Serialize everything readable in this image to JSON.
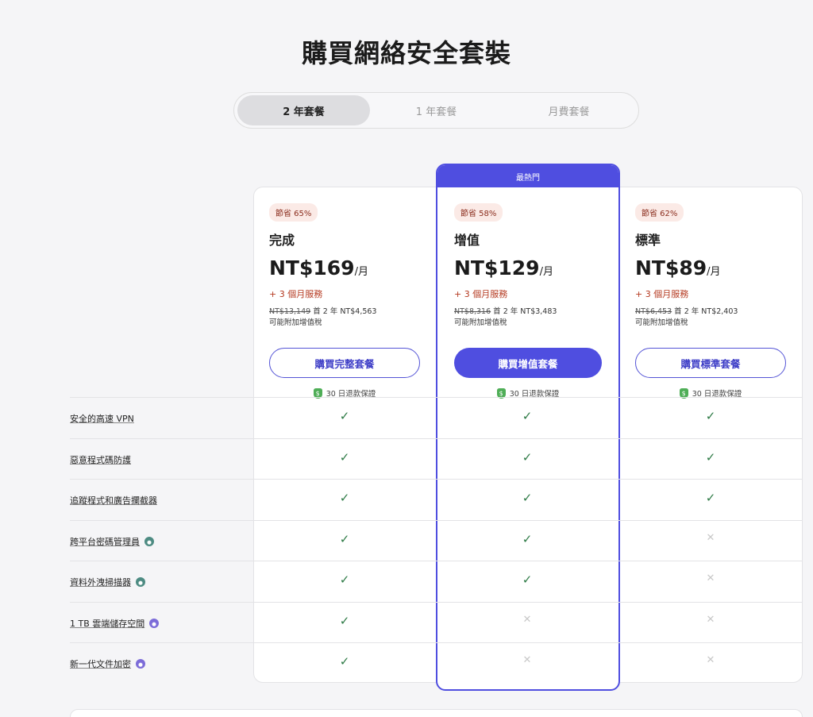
{
  "page": {
    "title": "購買網絡安全套裝"
  },
  "tabs": [
    {
      "label": "2 年套餐",
      "active": true
    },
    {
      "label": "1 年套餐",
      "active": false
    },
    {
      "label": "月費套餐",
      "active": false
    }
  ],
  "featured_label": "最熱門",
  "plans": [
    {
      "badge": "節省 65%",
      "name": "完成",
      "price": "NT$169",
      "per": "/月",
      "bonus": "+ 3 個月服務",
      "old_price": "NT$13,149",
      "term": " 首 2 年 ",
      "total": "NT$4,563",
      "tax": "可能附加增值稅",
      "button": "購買完整套餐",
      "guarantee": "30 日退款保證"
    },
    {
      "badge": "節省 58%",
      "name": "增值",
      "price": "NT$129",
      "per": "/月",
      "bonus": "+ 3 個月服務",
      "old_price": "NT$8,316",
      "term": " 首 2 年 ",
      "total": "NT$3,483",
      "tax": "可能附加增值稅",
      "button": "購買增值套餐",
      "guarantee": "30 日退款保證"
    },
    {
      "badge": "節省 62%",
      "name": "標準",
      "price": "NT$89",
      "per": "/月",
      "bonus": "+ 3 個月服務",
      "old_price": "NT$6,453",
      "term": " 首 2 年 ",
      "total": "NT$2,403",
      "tax": "可能附加增值稅",
      "button": "購買標準套餐",
      "guarantee": "30 日退款保證"
    }
  ],
  "features": [
    {
      "label": "安全的高速 VPN",
      "icon": "",
      "values": [
        true,
        true,
        true
      ]
    },
    {
      "label": "惡意程式碼防護",
      "icon": "",
      "values": [
        true,
        true,
        true
      ]
    },
    {
      "label": "追蹤程式和廣告攔截器",
      "icon": "",
      "values": [
        true,
        true,
        true
      ]
    },
    {
      "label": "跨平台密碼管理員",
      "icon": "teal",
      "values": [
        true,
        true,
        false
      ]
    },
    {
      "label": "資料外洩掃描器",
      "icon": "teal",
      "values": [
        true,
        true,
        false
      ]
    },
    {
      "label": "1 TB 雲端儲存空間",
      "icon": "violet",
      "values": [
        true,
        false,
        false
      ]
    },
    {
      "label": "新一代文件加密",
      "icon": "violet",
      "values": [
        true,
        false,
        false
      ]
    }
  ],
  "marks": {
    "yes": "✓",
    "no": "✕"
  },
  "colors": {
    "accent": "#4f4ee0",
    "check": "#2d7a45",
    "bonus": "#b4381f",
    "badge_bg": "#fbeae6"
  }
}
